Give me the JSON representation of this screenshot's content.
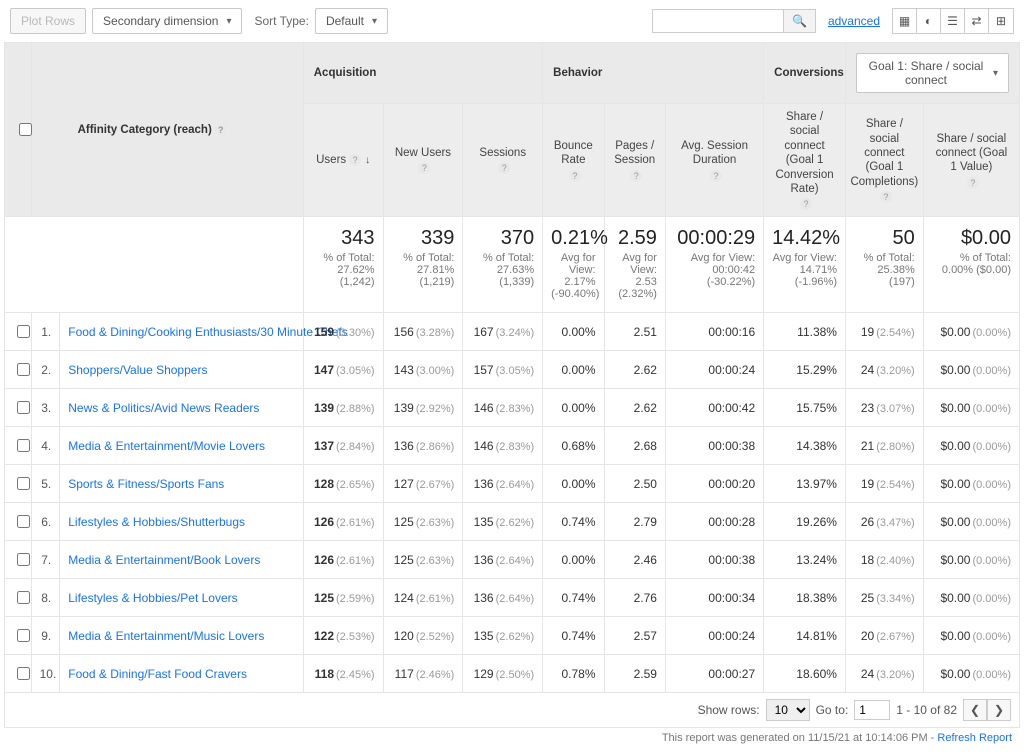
{
  "toolbar": {
    "plotRows": "Plot Rows",
    "secondaryDim": "Secondary dimension",
    "sortTypeLabel": "Sort Type:",
    "sortType": "Default",
    "advanced": "advanced"
  },
  "goalSelector": "Goal 1: Share / social connect",
  "groupHeaders": {
    "dimension": "Affinity Category (reach)",
    "acquisition": "Acquisition",
    "behavior": "Behavior",
    "conversions": "Conversions"
  },
  "columns": {
    "users": "Users",
    "newUsers": "New Users",
    "sessions": "Sessions",
    "bounce": "Bounce Rate",
    "pps": "Pages / Session",
    "avgDur": "Avg. Session Duration",
    "cv1": "Share / social connect (Goal 1 Conversion Rate)",
    "cv2": "Share / social connect (Goal 1 Completions)",
    "cv3": "Share / social connect (Goal 1 Value)"
  },
  "summary": {
    "users": {
      "big": "343",
      "sub1": "% of Total:",
      "sub2": "27.62%",
      "sub3": "(1,242)"
    },
    "newUsers": {
      "big": "339",
      "sub1": "% of Total:",
      "sub2": "27.81%",
      "sub3": "(1,219)"
    },
    "sessions": {
      "big": "370",
      "sub1": "% of Total:",
      "sub2": "27.63%",
      "sub3": "(1,339)"
    },
    "bounce": {
      "big": "0.21%",
      "sub1": "Avg for View:",
      "sub2": "2.17%",
      "sub3": "(-90.40%)"
    },
    "pps": {
      "big": "2.59",
      "sub1": "Avg for View:",
      "sub2": "2.53",
      "sub3": "(2.32%)"
    },
    "avgDur": {
      "big": "00:00:29",
      "sub1": "Avg for View:",
      "sub2": "00:00:42",
      "sub3": "(-30.22%)"
    },
    "cv1": {
      "big": "14.42%",
      "sub1": "Avg for View:",
      "sub2": "14.71%",
      "sub3": "(-1.96%)"
    },
    "cv2": {
      "big": "50",
      "sub1": "% of Total:",
      "sub2": "25.38% (197)",
      "sub3": ""
    },
    "cv3": {
      "big": "$0.00",
      "sub1": "% of Total:",
      "sub2": "0.00% ($0.00)",
      "sub3": ""
    }
  },
  "rows": [
    {
      "n": "1.",
      "cat": "Food & Dining/Cooking Enthusiasts/30 Minute Chefs",
      "users": "159",
      "usersPct": "(3.30%)",
      "nu": "156",
      "nuPct": "(3.28%)",
      "sess": "167",
      "sessPct": "(3.24%)",
      "bounce": "0.00%",
      "pps": "2.51",
      "dur": "00:00:16",
      "cv1": "11.38%",
      "cv2": "19",
      "cv2Pct": "(2.54%)",
      "cv3": "$0.00",
      "cv3Pct": "(0.00%)"
    },
    {
      "n": "2.",
      "cat": "Shoppers/Value Shoppers",
      "users": "147",
      "usersPct": "(3.05%)",
      "nu": "143",
      "nuPct": "(3.00%)",
      "sess": "157",
      "sessPct": "(3.05%)",
      "bounce": "0.00%",
      "pps": "2.62",
      "dur": "00:00:24",
      "cv1": "15.29%",
      "cv2": "24",
      "cv2Pct": "(3.20%)",
      "cv3": "$0.00",
      "cv3Pct": "(0.00%)"
    },
    {
      "n": "3.",
      "cat": "News & Politics/Avid News Readers",
      "users": "139",
      "usersPct": "(2.88%)",
      "nu": "139",
      "nuPct": "(2.92%)",
      "sess": "146",
      "sessPct": "(2.83%)",
      "bounce": "0.00%",
      "pps": "2.62",
      "dur": "00:00:42",
      "cv1": "15.75%",
      "cv2": "23",
      "cv2Pct": "(3.07%)",
      "cv3": "$0.00",
      "cv3Pct": "(0.00%)"
    },
    {
      "n": "4.",
      "cat": "Media & Entertainment/Movie Lovers",
      "users": "137",
      "usersPct": "(2.84%)",
      "nu": "136",
      "nuPct": "(2.86%)",
      "sess": "146",
      "sessPct": "(2.83%)",
      "bounce": "0.68%",
      "pps": "2.68",
      "dur": "00:00:38",
      "cv1": "14.38%",
      "cv2": "21",
      "cv2Pct": "(2.80%)",
      "cv3": "$0.00",
      "cv3Pct": "(0.00%)"
    },
    {
      "n": "5.",
      "cat": "Sports & Fitness/Sports Fans",
      "users": "128",
      "usersPct": "(2.65%)",
      "nu": "127",
      "nuPct": "(2.67%)",
      "sess": "136",
      "sessPct": "(2.64%)",
      "bounce": "0.00%",
      "pps": "2.50",
      "dur": "00:00:20",
      "cv1": "13.97%",
      "cv2": "19",
      "cv2Pct": "(2.54%)",
      "cv3": "$0.00",
      "cv3Pct": "(0.00%)"
    },
    {
      "n": "6.",
      "cat": "Lifestyles & Hobbies/Shutterbugs",
      "users": "126",
      "usersPct": "(2.61%)",
      "nu": "125",
      "nuPct": "(2.63%)",
      "sess": "135",
      "sessPct": "(2.62%)",
      "bounce": "0.74%",
      "pps": "2.79",
      "dur": "00:00:28",
      "cv1": "19.26%",
      "cv2": "26",
      "cv2Pct": "(3.47%)",
      "cv3": "$0.00",
      "cv3Pct": "(0.00%)"
    },
    {
      "n": "7.",
      "cat": "Media & Entertainment/Book Lovers",
      "users": "126",
      "usersPct": "(2.61%)",
      "nu": "125",
      "nuPct": "(2.63%)",
      "sess": "136",
      "sessPct": "(2.64%)",
      "bounce": "0.00%",
      "pps": "2.46",
      "dur": "00:00:38",
      "cv1": "13.24%",
      "cv2": "18",
      "cv2Pct": "(2.40%)",
      "cv3": "$0.00",
      "cv3Pct": "(0.00%)"
    },
    {
      "n": "8.",
      "cat": "Lifestyles & Hobbies/Pet Lovers",
      "users": "125",
      "usersPct": "(2.59%)",
      "nu": "124",
      "nuPct": "(2.61%)",
      "sess": "136",
      "sessPct": "(2.64%)",
      "bounce": "0.74%",
      "pps": "2.76",
      "dur": "00:00:34",
      "cv1": "18.38%",
      "cv2": "25",
      "cv2Pct": "(3.34%)",
      "cv3": "$0.00",
      "cv3Pct": "(0.00%)"
    },
    {
      "n": "9.",
      "cat": "Media & Entertainment/Music Lovers",
      "users": "122",
      "usersPct": "(2.53%)",
      "nu": "120",
      "nuPct": "(2.52%)",
      "sess": "135",
      "sessPct": "(2.62%)",
      "bounce": "0.74%",
      "pps": "2.57",
      "dur": "00:00:24",
      "cv1": "14.81%",
      "cv2": "20",
      "cv2Pct": "(2.67%)",
      "cv3": "$0.00",
      "cv3Pct": "(0.00%)"
    },
    {
      "n": "10.",
      "cat": "Food & Dining/Fast Food Cravers",
      "users": "118",
      "usersPct": "(2.45%)",
      "nu": "117",
      "nuPct": "(2.46%)",
      "sess": "129",
      "sessPct": "(2.50%)",
      "bounce": "0.78%",
      "pps": "2.59",
      "dur": "00:00:27",
      "cv1": "18.60%",
      "cv2": "24",
      "cv2Pct": "(3.20%)",
      "cv3": "$0.00",
      "cv3Pct": "(0.00%)"
    }
  ],
  "footer": {
    "showRows": "Show rows:",
    "rowsValue": "10",
    "goTo": "Go to:",
    "goToValue": "1",
    "range": "1 - 10 of 82",
    "prev": "❮",
    "next": "❯"
  },
  "subfooter": {
    "text": "This report was generated on 11/15/21 at 10:14:06 PM - ",
    "refresh": "Refresh Report"
  }
}
